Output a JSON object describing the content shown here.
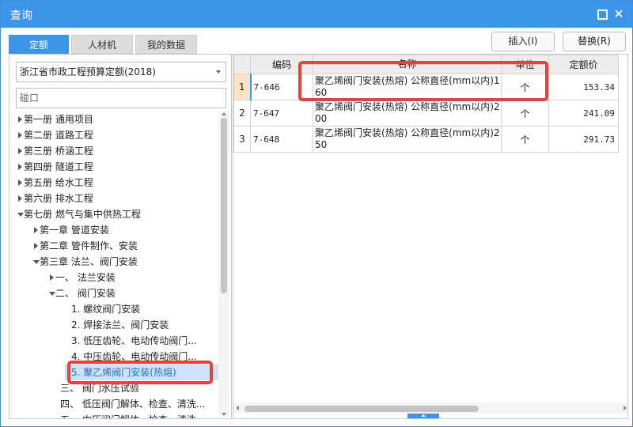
{
  "window": {
    "title": "查询",
    "maximize_icon": "maximize-icon",
    "close_icon": "close-icon"
  },
  "tabs": [
    {
      "label": "定额",
      "active": true
    },
    {
      "label": "人材机"
    },
    {
      "label": "我的数据"
    }
  ],
  "toolbar": {
    "insert_label": "插入(I)",
    "replace_label": "替换(R)"
  },
  "quota_select": {
    "value": "浙江省市政工程预算定额(2018)"
  },
  "search": {
    "value": "碰口"
  },
  "tree": [
    {
      "label": "第一册 通用项目",
      "caret": "right"
    },
    {
      "label": "第二册 道路工程",
      "caret": "right"
    },
    {
      "label": "第三册 桥涵工程",
      "caret": "right"
    },
    {
      "label": "第四册 隧道工程",
      "caret": "right"
    },
    {
      "label": "第五册 给水工程",
      "caret": "right"
    },
    {
      "label": "第六册 排水工程",
      "caret": "right"
    },
    {
      "label": "第七册 燃气与集中供热工程",
      "caret": "down"
    },
    {
      "label": "第一章 管道安装",
      "caret": "right"
    },
    {
      "label": "第二章 管件制作、安装",
      "caret": "right"
    },
    {
      "label": "第三章 法兰、阀门安装",
      "caret": "down"
    },
    {
      "label": "一、 法兰安装",
      "caret": "right"
    },
    {
      "label": "二、 阀门安装",
      "caret": "down"
    },
    {
      "label": "1. 螺纹阀门安装"
    },
    {
      "label": "2. 焊接法兰、阀门安装"
    },
    {
      "label": "3. 低压齿轮、电动传动阀门..."
    },
    {
      "label": "4. 中压齿轮、电动传动阀门..."
    },
    {
      "label": "5. 聚乙烯阀门安装(热熔)",
      "selected": true
    },
    {
      "label": "三、 阀门水压试验"
    },
    {
      "label": "四、 低压阀门解体、检查、清洗..."
    },
    {
      "label": "五、 中压阀门解体、检查、清洗..."
    }
  ],
  "grid": {
    "columns": [
      "",
      "编码",
      "名称",
      "单位",
      "定额价"
    ],
    "rows": [
      {
        "idx": "1",
        "code": "7-646",
        "name": "聚乙烯阀门安装(热熔) 公称直径(mm以内)160",
        "unit": "个",
        "price": "153.34"
      },
      {
        "idx": "2",
        "code": "7-647",
        "name": "聚乙烯阀门安装(热熔) 公称直径(mm以内)200",
        "unit": "个",
        "price": "241.09"
      },
      {
        "idx": "3",
        "code": "7-648",
        "name": "聚乙烯阀门安装(热熔) 公称直径(mm以内)250",
        "unit": "个",
        "price": "291.73"
      }
    ]
  },
  "colors": {
    "accent": "#3c95e8",
    "highlight": "#e8403b",
    "selected_row": "#cce4fb"
  }
}
